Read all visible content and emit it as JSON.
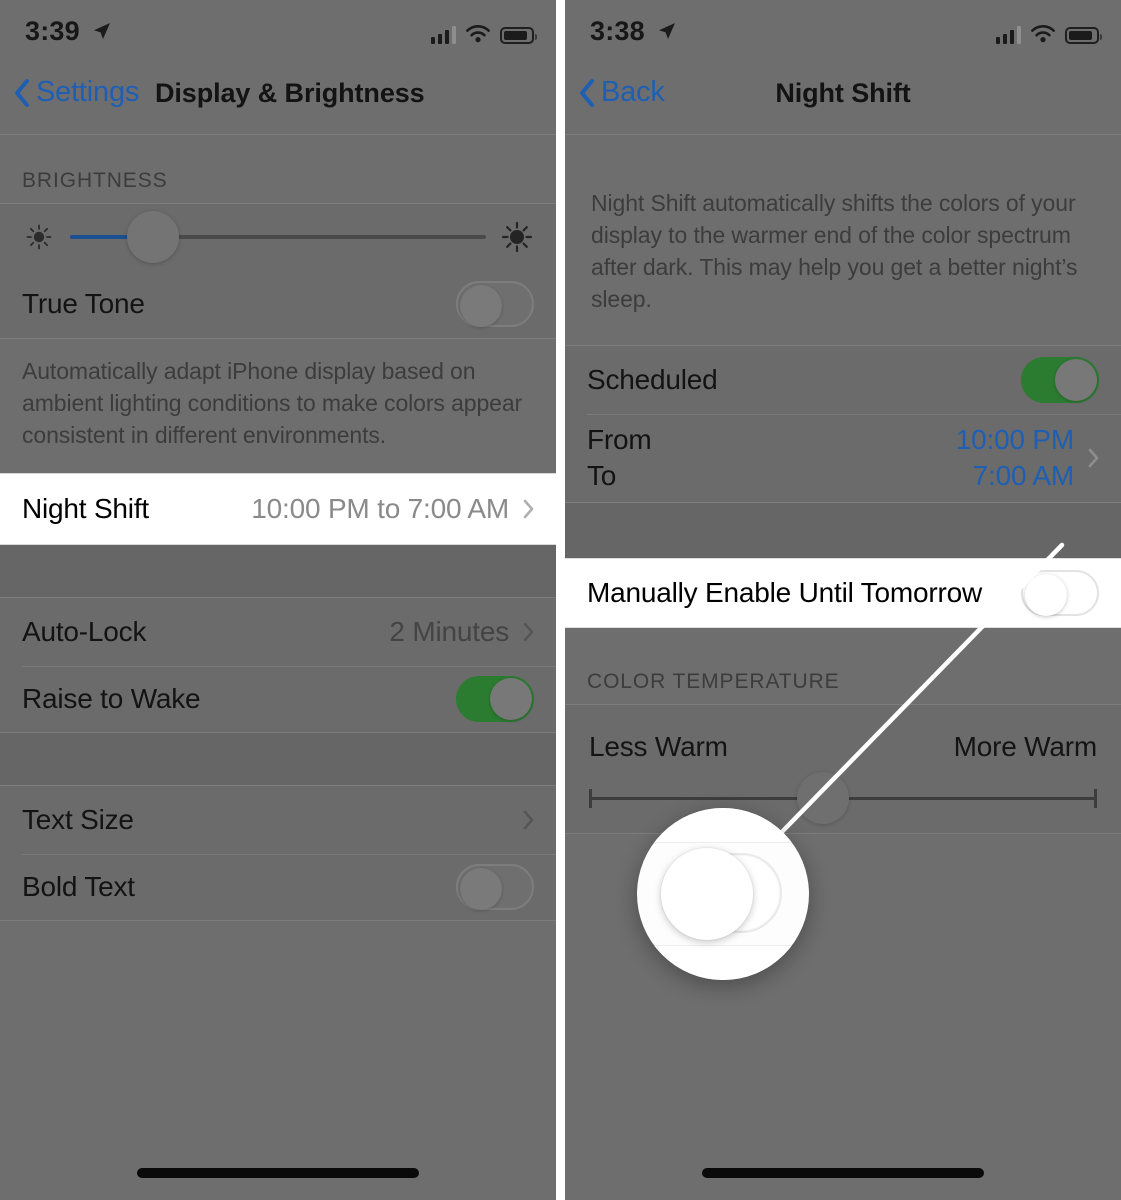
{
  "left_phone": {
    "status_bar": {
      "time": "3:39",
      "location_icon": "location-arrow-icon",
      "signal_icon": "cellular-signal-icon",
      "wifi_icon": "wifi-icon",
      "battery_icon": "battery-icon"
    },
    "nav": {
      "back_label": "Settings",
      "back_icon": "chevron-left-icon",
      "title": "Display & Brightness"
    },
    "brightness_section": {
      "header": "BRIGHTNESS",
      "slider": {
        "low_icon": "brightness-low-icon",
        "high_icon": "brightness-high-icon",
        "value_percent": 20
      },
      "true_tone": {
        "label": "True Tone",
        "toggle_state": "off"
      },
      "note": "Automatically adapt iPhone display based on ambient lighting conditions to make colors appear consistent in different environments."
    },
    "night_shift_row": {
      "label": "Night Shift",
      "value": "10:00 PM to 7:00 AM",
      "chevron_icon": "chevron-right-icon",
      "highlighted": true
    },
    "lock_section": {
      "auto_lock": {
        "label": "Auto-Lock",
        "value": "2 Minutes",
        "chevron_icon": "chevron-right-icon"
      },
      "raise_to_wake": {
        "label": "Raise to Wake",
        "toggle_state": "on"
      }
    },
    "text_section": {
      "text_size": {
        "label": "Text Size",
        "chevron_icon": "chevron-right-icon"
      },
      "bold_text": {
        "label": "Bold Text",
        "toggle_state": "off"
      }
    },
    "home_indicator": "home-indicator"
  },
  "right_phone": {
    "status_bar": {
      "time": "3:38",
      "location_icon": "location-arrow-icon",
      "signal_icon": "cellular-signal-icon",
      "wifi_icon": "wifi-icon",
      "battery_icon": "battery-icon"
    },
    "nav": {
      "back_label": "Back",
      "back_icon": "chevron-left-icon",
      "title": "Night Shift"
    },
    "description": "Night Shift automatically shifts the colors of your display to the warmer end of the color spectrum after dark. This may help you get a better night’s sleep.",
    "scheduled_section": {
      "scheduled": {
        "label": "Scheduled",
        "toggle_state": "on"
      },
      "from": {
        "label": "From",
        "value": "10:00 PM"
      },
      "to": {
        "label": "To",
        "value": "7:00 AM"
      },
      "chevron_icon": "chevron-right-icon"
    },
    "manual_row": {
      "label": "Manually Enable Until Tomorrow",
      "toggle_state": "off",
      "highlighted": true
    },
    "color_temperature_section": {
      "header": "COLOR TEMPERATURE",
      "left_label": "Less Warm",
      "right_label": "More Warm",
      "value_percent": 46
    },
    "home_indicator": "home-indicator"
  },
  "callout": {
    "kind": "magnifier-callout",
    "target": "manual-enable-toggle",
    "magnified_toggle_state": "off"
  },
  "colors": {
    "accent_blue": "#1e5fb4",
    "toggle_green": "#2b7b31",
    "dim_overlay": "#6b6b6b",
    "highlight_white": "#ffffff",
    "brightness_fill": "#1b4f93"
  }
}
